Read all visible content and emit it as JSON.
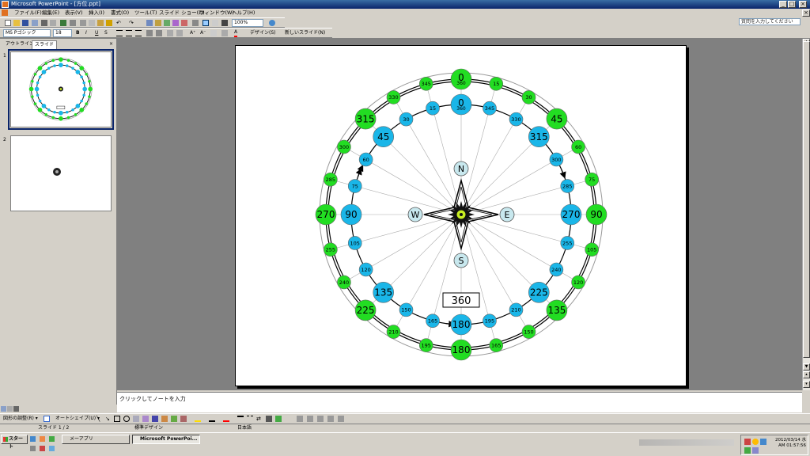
{
  "window": {
    "title": "Microsoft PowerPoint - [方位.ppt]"
  },
  "menu": {
    "items": [
      "ファイル(F)",
      "編集(E)",
      "表示(V)",
      "挿入(I)",
      "書式(O)",
      "ツール(T)",
      "スライド ショー(D)",
      "ウィンドウ(W)",
      "ヘルプ(H)"
    ],
    "help_placeholder": "質問を入力してください"
  },
  "toolbar": {
    "zoom": "100%",
    "font": "MS Pゴシック",
    "size": "18",
    "bold": "B",
    "italic": "I",
    "underline": "U",
    "shadow": "S",
    "font_color": "A",
    "design_label": "デザイン(S)",
    "new_slide_label": "新しいスライド(N)"
  },
  "outline_pane": {
    "tab_outline": "アウトライン",
    "tab_slides": "スライド",
    "close": "×",
    "slide_numbers": [
      "1",
      "2"
    ]
  },
  "slide": {
    "outer_labels": [
      "0",
      "45",
      "90",
      "135",
      "180",
      "225",
      "270",
      "315"
    ],
    "outer_small": [
      "345",
      "15",
      "30",
      "60",
      "75",
      "105",
      "120",
      "150",
      "165",
      "195",
      "210",
      "240",
      "255",
      "285",
      "300",
      "330"
    ],
    "inner_labels": [
      "0",
      "45",
      "90",
      "135",
      "180",
      "225",
      "270",
      "315"
    ],
    "inner_small": [
      "15",
      "30",
      "60",
      "75",
      "105",
      "120",
      "150",
      "165",
      "195",
      "210",
      "240",
      "255",
      "285",
      "300",
      "330",
      "345"
    ],
    "sub_360": "360",
    "directions": {
      "n": "N",
      "e": "E",
      "s": "S",
      "w": "W"
    },
    "readout": "360",
    "colors": {
      "outer": "#22dd22",
      "inner": "#1ab6e8",
      "dir": "#c8e8ee",
      "center": "#c8ee22"
    }
  },
  "notes": {
    "placeholder": "クリックしてノートを入力"
  },
  "draw_toolbar": {
    "draw_label": "図形の調整(R) ▾",
    "autoshapes_label": "オートシェイプ(U) ▾"
  },
  "status": {
    "slide": "スライド 1 / 2",
    "design": "標準デザイン",
    "lang": "日本語"
  },
  "taskbar": {
    "start": "スタート",
    "btn1": "メーアプリ",
    "btn2": "Microsoft PowerPoi...",
    "clock_time": "AM 01:57:56",
    "clock_date": "2012/03/14 水"
  }
}
